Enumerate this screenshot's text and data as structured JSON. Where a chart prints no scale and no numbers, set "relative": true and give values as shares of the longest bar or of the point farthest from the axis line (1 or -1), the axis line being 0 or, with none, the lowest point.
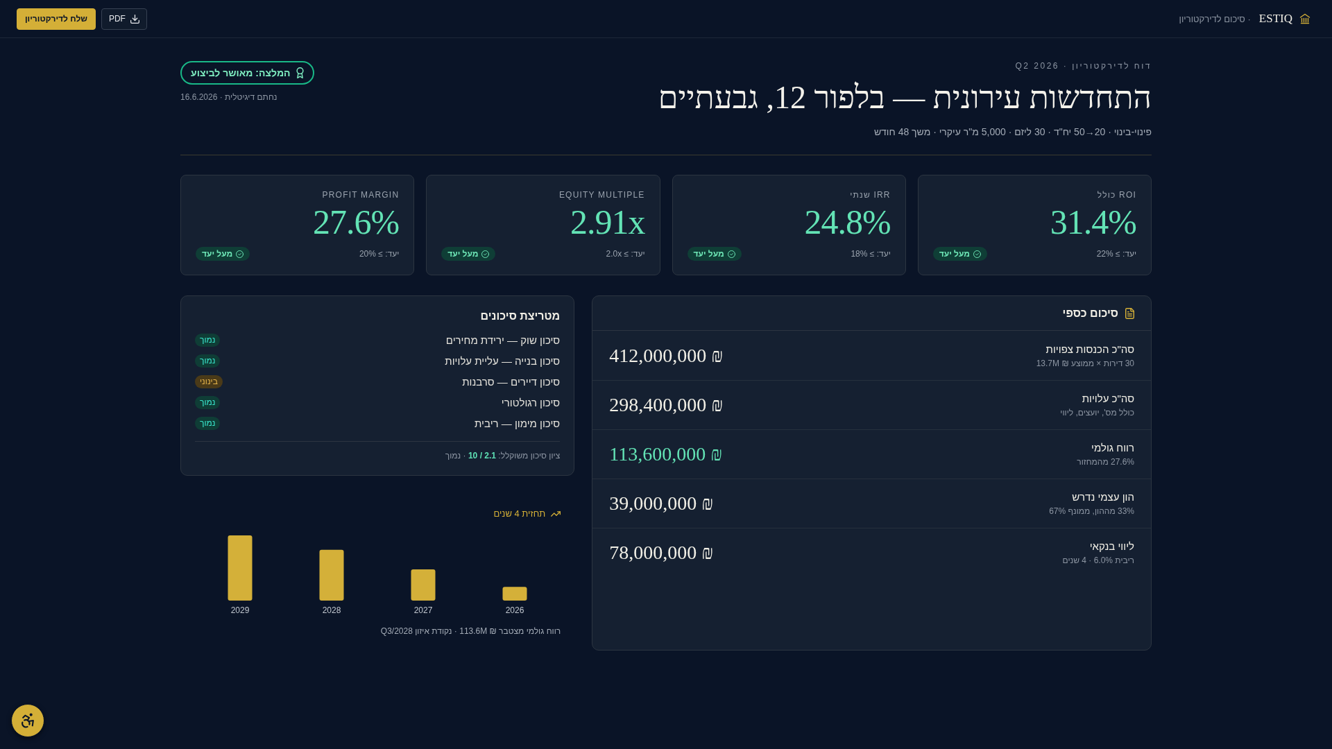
{
  "topbar": {
    "brand": "ESTIQ",
    "subtitle": "· סיכום לדירקטוריון",
    "buttons": [
      {
        "label": "PDF",
        "kind": "download"
      },
      {
        "label": "שלח לדירקטוריון",
        "kind": "primary"
      }
    ]
  },
  "header": {
    "kicker": "דוח לדירקטוריון · Q2 2026",
    "title": "התחדשות עירונית — בלפור 12, גבעתיים",
    "subtitle": "פינוי-בינוי · 20→50 יח\"ד · 30 ליזם · 5,000 מ\"ר עיקרי · משך 48 חודש",
    "recommendation": {
      "label": "המלצה: מאושר לביצוע",
      "approved": true
    },
    "signature": "נחתם דיגיטלית · 16.6.2026"
  },
  "kpis": [
    {
      "label": "ROI כולל",
      "value": "31.4%",
      "target": "יעד: ≥ 22%",
      "badge": "מעל יעד",
      "met": true
    },
    {
      "label": "IRR שנתי",
      "value": "24.8%",
      "target": "יעד: ≥ 18%",
      "badge": "מעל יעד",
      "met": true
    },
    {
      "label": "EQUITY MULTIPLE",
      "value": "2.91x",
      "target": "יעד: ≥ 2.0x",
      "badge": "מעל יעד",
      "met": true
    },
    {
      "label": "PROFIT MARGIN",
      "value": "27.6%",
      "target": "יעד: ≥ 20%",
      "badge": "מעל יעד",
      "met": true
    }
  ],
  "financial_summary": {
    "title": "סיכום כספי",
    "rows": [
      {
        "label": "סה\"כ הכנסות צפויות",
        "note": "30 דירות × ממוצע ₪ 13.7M",
        "value": "412,000,000 ₪",
        "highlight": false
      },
      {
        "label": "סה\"כ עלויות",
        "note": "כולל מס', יועצים, ליווי",
        "value": "298,400,000 ₪",
        "highlight": false
      },
      {
        "label": "רווח גולמי",
        "note": "27.6% מהמחזור",
        "value": "113,600,000 ₪",
        "highlight": true
      },
      {
        "label": "הון עצמי נדרש",
        "note": "33% מההון, ממונף 67%",
        "value": "39,000,000 ₪",
        "highlight": false
      },
      {
        "label": "ליווי בנקאי",
        "note": "ריבית 6.0% · 4 שנים",
        "value": "78,000,000 ₪",
        "highlight": false
      }
    ]
  },
  "risk_matrix": {
    "title": "מטריצת סיכונים",
    "rows": [
      {
        "label": "סיכון שוק — ירידת מחירים",
        "rating": "נמוך",
        "color": "#0f3d36"
      },
      {
        "label": "סיכון בנייה — עליית עלויות",
        "rating": "נמוך",
        "color": "#0f3d36"
      },
      {
        "label": "סיכון דיירים — סרבנות",
        "rating": "בינוני",
        "color": "#4a3a18"
      },
      {
        "label": "סיכון רגולטורי",
        "rating": "נמוך",
        "color": "#0f3d36"
      },
      {
        "label": "סיכון מימון — ריבית",
        "rating": "נמוך",
        "color": "#0f3d36"
      }
    ],
    "footer": "ציון סיכון משוקלל: **2.1 / 10** · נמוך"
  },
  "forecast": {
    "title": "תחזית 4 שנים",
    "chart_data": {
      "type": "bar",
      "relative": true,
      "categories": [
        "2029",
        "2028",
        "2027",
        "2026"
      ],
      "values": [
        1,
        0.78,
        0.48,
        0.21
      ]
    },
    "caption": "רווח גולמי מצטבר ₪ 113.6M · נקודת איזון Q3/2028"
  }
}
